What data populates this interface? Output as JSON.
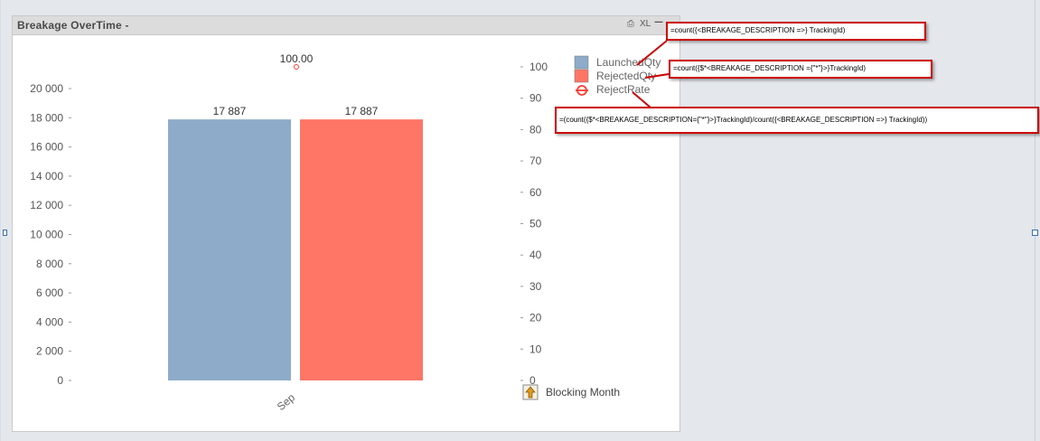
{
  "panel": {
    "title": "Breakage OverTime -",
    "icon_print": "print-icon",
    "icon_xl": "XL",
    "icon_minimize": "minimize-icon"
  },
  "chart_data": {
    "type": "bar",
    "categories": [
      "Sep"
    ],
    "series": [
      {
        "name": "LaunchedQty",
        "values": [
          17887
        ],
        "labels": [
          "17 887"
        ],
        "color": "#8eabc9",
        "axis": "left",
        "mark": "bar"
      },
      {
        "name": "RejectedQty",
        "values": [
          17887
        ],
        "labels": [
          "17 887"
        ],
        "color": "#ff7566",
        "axis": "left",
        "mark": "bar"
      },
      {
        "name": "RejectRate",
        "values": [
          100
        ],
        "labels": [
          "100.00"
        ],
        "color": "#ff3b2f",
        "axis": "right",
        "mark": "circle"
      }
    ],
    "y_left": {
      "ylim": [
        0,
        20000
      ],
      "ticks": [
        0,
        2000,
        4000,
        6000,
        8000,
        10000,
        12000,
        14000,
        16000,
        18000,
        20000
      ],
      "tick_labels": [
        "0",
        "2 000",
        "4 000",
        "6 000",
        "8 000",
        "10 000",
        "12 000",
        "14 000",
        "16 000",
        "18 000",
        "20 000"
      ]
    },
    "y_right": {
      "ylim": [
        0,
        100
      ],
      "ticks": [
        0,
        10,
        20,
        30,
        40,
        50,
        60,
        70,
        80,
        90,
        100
      ],
      "tick_labels": [
        "0",
        "10",
        "20",
        "30",
        "40",
        "50",
        "60",
        "70",
        "80",
        "90",
        "100"
      ]
    },
    "legend_placement": "top-right",
    "grid": false
  },
  "dimension_label": "Blocking Month",
  "callouts": [
    {
      "text": "=count({<BREAKAGE_DESCRIPTION =>} TrackingId)"
    },
    {
      "text": "=count({$*<BREAKAGE_DESCRIPTION ={\"*\"}>}TrackingId)"
    },
    {
      "text": "=(count({$*<BREAKAGE_DESCRIPTION={\"*\"}>}TrackingId)/count({<BREAKAGE_DESCRIPTION =>} TrackingId))"
    }
  ]
}
